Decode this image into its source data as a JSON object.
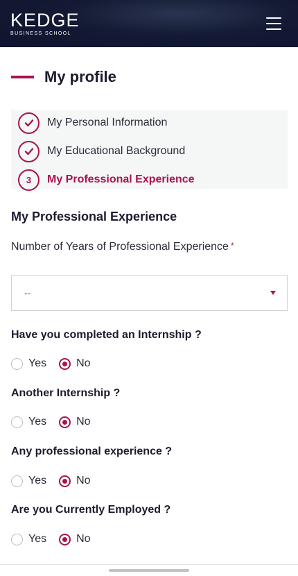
{
  "header": {
    "logo_main": "KEDGE",
    "logo_sub": "BUSINESS SCHOOL",
    "menu_icon": "hamburger-icon"
  },
  "page": {
    "title": "My profile"
  },
  "steps": [
    {
      "label": "My Personal Information",
      "state": "done",
      "icon": "check-icon"
    },
    {
      "label": "My Educational Background",
      "state": "done",
      "icon": "check-icon"
    },
    {
      "label": "My Professional Experience",
      "state": "active",
      "number": "3"
    }
  ],
  "form": {
    "section_title": "My Professional Experience",
    "years_label": "Number of Years of Professional Experience",
    "required_mark": "*",
    "years_value": "--",
    "questions": [
      {
        "label": "Have you completed an Internship ?",
        "yes": "Yes",
        "no": "No",
        "selected": "No"
      },
      {
        "label": "Another Internship ?",
        "yes": "Yes",
        "no": "No",
        "selected": "No"
      },
      {
        "label": "Any professional experience ?",
        "yes": "Yes",
        "no": "No",
        "selected": "No"
      },
      {
        "label": "Are you Currently Employed ?",
        "yes": "Yes",
        "no": "No",
        "selected": "No"
      }
    ]
  },
  "colors": {
    "brand_navy": "#141a33",
    "accent": "#a8144e"
  }
}
